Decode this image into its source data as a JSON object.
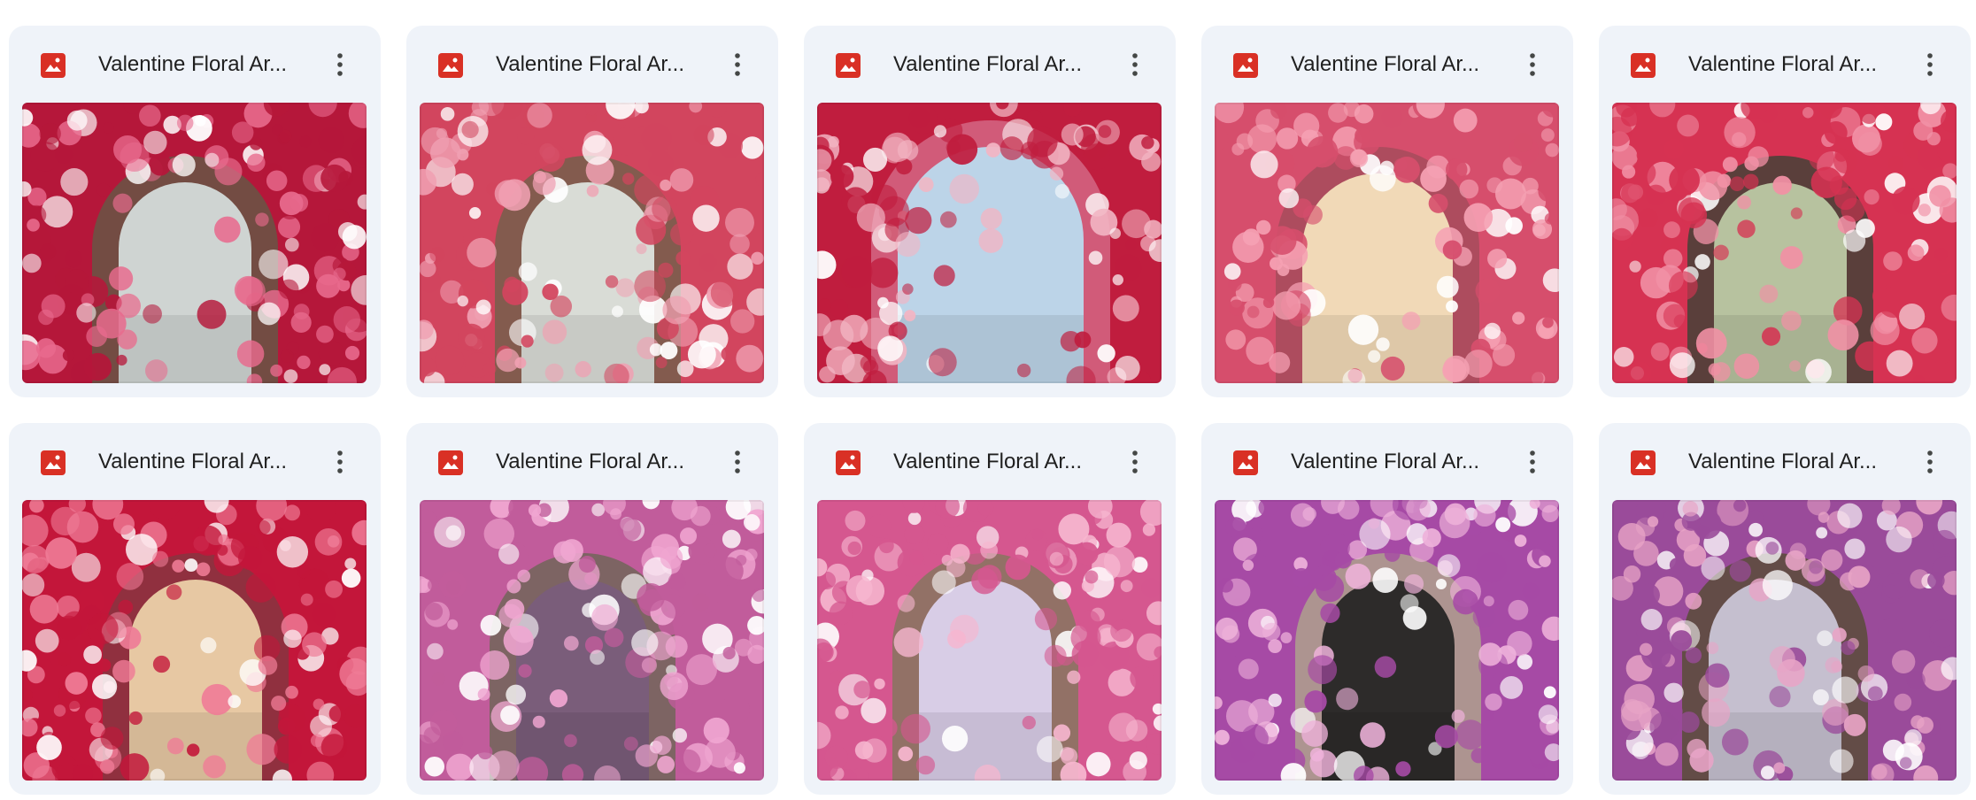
{
  "files": [
    {
      "title": "Valentine Floral Ar...",
      "icon": "image-file-icon",
      "thumb": {
        "sky": "#cfd4d2",
        "floralA": "#b5173a",
        "floralB": "#e86a8d",
        "arch": "#6b5245",
        "arch_style": "stone-arch"
      }
    },
    {
      "title": "Valentine Floral Ar...",
      "icon": "image-file-icon",
      "thumb": {
        "sky": "#d9dcd6",
        "floralA": "#d2455e",
        "floralB": "#f0a0b2",
        "arch": "#7a5d4d",
        "arch_style": "ornate-arch"
      }
    },
    {
      "title": "Valentine Floral Ar...",
      "icon": "image-file-icon",
      "thumb": {
        "sky": "#bcd4e8",
        "floralA": "#c01d3e",
        "floralB": "#f2b5c3",
        "arch": "#d3637f",
        "arch_style": "flower-ring"
      }
    },
    {
      "title": "Valentine Floral Ar...",
      "icon": "image-file-icon",
      "thumb": {
        "sky": "#f1d9b7",
        "floralA": "#d64e6c",
        "floralB": "#f5a1b3",
        "arch": "#a84d5d",
        "arch_style": "flower-arch"
      }
    },
    {
      "title": "Valentine Floral Ar...",
      "icon": "image-file-icon",
      "thumb": {
        "sky": "#b7c29f",
        "floralA": "#d63252",
        "floralB": "#f190a5",
        "arch": "#4d4038",
        "arch_style": "window-arch"
      }
    },
    {
      "title": "Valentine Floral Ar...",
      "icon": "image-file-icon",
      "thumb": {
        "sky": "#e7c8a3",
        "floralA": "#c3163a",
        "floralB": "#ef7b96",
        "arch": "#8b3340",
        "arch_style": "rose-arch"
      }
    },
    {
      "title": "Valentine Floral Ar...",
      "icon": "image-file-icon",
      "thumb": {
        "sky": "#7a5d7a",
        "floralA": "#c15c9b",
        "floralB": "#f0a6d1",
        "arch": "#76655d",
        "arch_style": "ornate-arch"
      }
    },
    {
      "title": "Valentine Floral Ar...",
      "icon": "image-file-icon",
      "thumb": {
        "sky": "#d8cde6",
        "floralA": "#d5578f",
        "floralB": "#f6b6cf",
        "arch": "#8b7462",
        "arch_style": "stone-arch"
      }
    },
    {
      "title": "Valentine Floral Ar...",
      "icon": "image-file-icon",
      "thumb": {
        "sky": "#2d2b2a",
        "floralA": "#a64aa5",
        "floralB": "#eeb2da",
        "arch": "#ae9c8e",
        "arch_style": "dark-arch"
      }
    },
    {
      "title": "Valentine Floral Ar...",
      "icon": "image-file-icon",
      "thumb": {
        "sky": "#c5bfcf",
        "floralA": "#9a4b9a",
        "floralB": "#e8a4c6",
        "arch": "#5d4d3e",
        "arch_style": "vine-arch"
      }
    }
  ],
  "colors": {
    "card_bg": "#eff3f9",
    "title_text": "#1f1f1f",
    "icon_red": "#d93025",
    "more_dots": "#444746"
  }
}
